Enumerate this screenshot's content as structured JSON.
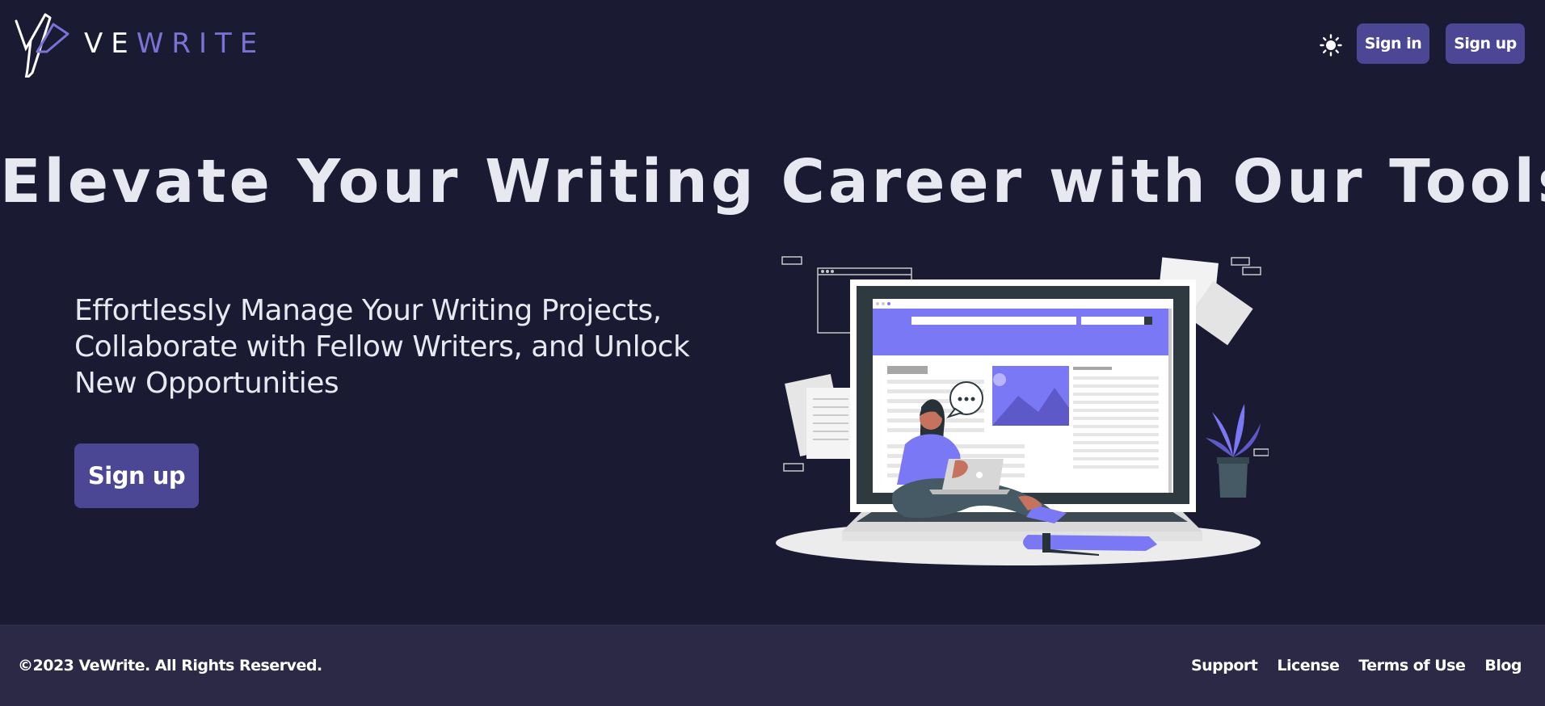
{
  "brand": {
    "name_part1": "VE",
    "name_part2": "WRITE",
    "accent_color": "#7a73d6"
  },
  "header": {
    "theme_icon": "sun-icon",
    "signin_label": "Sign in",
    "signup_label": "Sign up"
  },
  "hero": {
    "title": "Elevate Your Writing Career with Our Tools",
    "subtitle": "Effortlessly Manage Your Writing Projects, Collaborate with Fellow Writers, and Unlock New Opportunities",
    "cta_label": "Sign up"
  },
  "footer": {
    "copyright": "©2023 VeWrite. All Rights Reserved.",
    "links": [
      "Support",
      "License",
      "Terms of Use",
      "Blog"
    ]
  },
  "colors": {
    "background": "#1b1a33",
    "footer_bg": "#2b2946",
    "button": "#4b4795",
    "illustration_accent": "#7b78f5"
  }
}
